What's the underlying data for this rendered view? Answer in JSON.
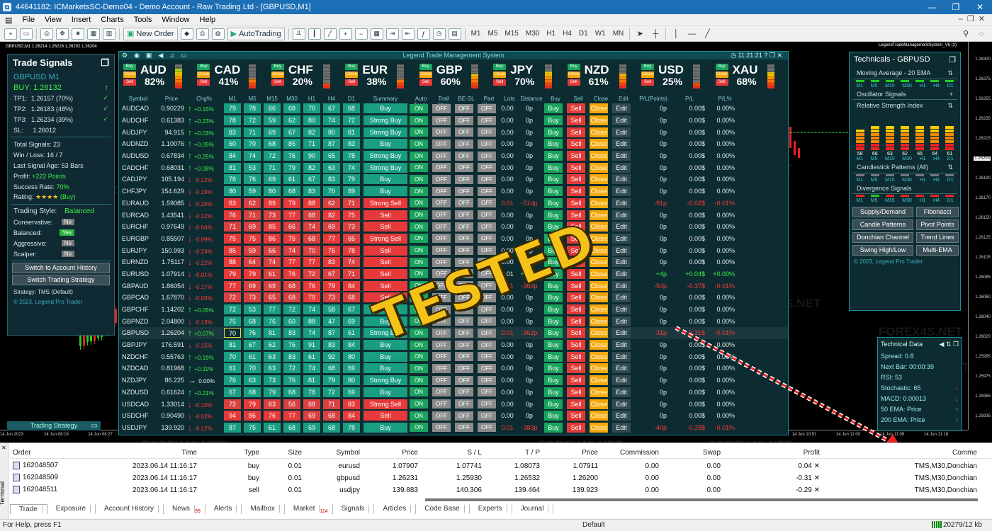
{
  "window": {
    "title": "44641182: ICMarketsSC-Demo04 - Demo Account - Raw Trading Ltd - [GBPUSD,M1]"
  },
  "menu": [
    "File",
    "View",
    "Insert",
    "Charts",
    "Tools",
    "Window",
    "Help"
  ],
  "toolbar": {
    "new_order": "New Order",
    "autotrading": "AutoTrading",
    "timeframes": [
      "M1",
      "M5",
      "M15",
      "M30",
      "H1",
      "H4",
      "D1",
      "W1",
      "MN"
    ]
  },
  "chart": {
    "symbol_label": "GBPUSD,M1  1.26214 1.26216 1.26202 1.26204",
    "indicator_label": "LegendTradeManagementSystem_V6 (2)",
    "prices": [
      "1.26300",
      "1.26275",
      "1.26255",
      "1.26235",
      "1.26215",
      "1.26203",
      "1.26190",
      "1.26170",
      "1.26150",
      "1.26125",
      "1.26105",
      "1.26085",
      "1.26060",
      "1.26040",
      "1.26020",
      "1.25995",
      "1.25975",
      "1.25955",
      "1.25935"
    ],
    "times": [
      "14 Jun 2023",
      "14 Jun 08:18",
      "14 Jun 08:27",
      "14 Jun 08:36",
      "14 Jun 08:45",
      "14 Jun 08:54",
      "14 Jun 09:03",
      "14 Jun 09:12",
      "14 Jun 09:21",
      "14 Jun 09:30",
      "14 Jun 09:39",
      "14 Jun 09:48",
      "14 Jun 09:57",
      "14 Jun 10:06",
      "14 Jun 10:15",
      "14 Jun 10:24",
      "14 Jun 10:33",
      "14 Jun 10:42",
      "14 Jun 10:51",
      "14 Jun 11:00",
      "14 Jun 11:09",
      "14 Jun 11:18"
    ],
    "watermark": "FOREX4S.NET"
  },
  "trade_signals": {
    "title": "Trade Signals",
    "pair": "GBPUSD M1",
    "buy": "BUY: 1.26132",
    "tps": [
      {
        "label": "TP1:",
        "value": "1.26157 (70%)"
      },
      {
        "label": "TP2:",
        "value": "1.26183 (48%)"
      },
      {
        "label": "TP3:",
        "value": "1.26234 (39%)"
      }
    ],
    "sl": {
      "label": "SL:",
      "value": "1.26012"
    },
    "stats": [
      {
        "label": "Total Signals:",
        "value": "23"
      },
      {
        "label": "Win / Loss:",
        "value": "16 / 7"
      },
      {
        "label": "Last Signal Age:",
        "value": "53 Bars"
      }
    ],
    "profit": {
      "label": "Profit:",
      "value": "+222 Points"
    },
    "success": {
      "label": "Success Rate:",
      "value": "70%"
    },
    "rating": {
      "label": "Rating:",
      "stars": "★★★★",
      "value": "(Buy)"
    },
    "style": {
      "label": "Trading Style:",
      "value": "Balanced"
    },
    "styles": [
      {
        "label": "Conservative:",
        "value": "No",
        "on": false
      },
      {
        "label": "Balanced:",
        "value": "Yes",
        "on": true
      },
      {
        "label": "Aggressive:",
        "value": "No",
        "on": false
      },
      {
        "label": "Scalper:",
        "value": "No",
        "on": false
      }
    ],
    "btn_history": "Switch to Account History",
    "btn_strategy": "Switch Trading Strategy",
    "strategy": "Strategy: TMS (Default)",
    "copyright": "© 2023, Legend Pro Trader",
    "collapsed_tab": "Trading Strategy"
  },
  "lts": {
    "title": "Legend Trade Management System",
    "clock": "11:21:21",
    "currencies": [
      {
        "name": "AUD",
        "pct": "82%",
        "level": 82
      },
      {
        "name": "CAD",
        "pct": "41%",
        "level": 41
      },
      {
        "name": "CHF",
        "pct": "20%",
        "level": 20
      },
      {
        "name": "EUR",
        "pct": "38%",
        "level": 38
      },
      {
        "name": "GBP",
        "pct": "60%",
        "level": 60
      },
      {
        "name": "JPY",
        "pct": "70%",
        "level": 70
      },
      {
        "name": "NZD",
        "pct": "61%",
        "level": 61
      },
      {
        "name": "USD",
        "pct": "25%",
        "level": 25
      },
      {
        "name": "XAU",
        "pct": "68%",
        "level": 68
      }
    ],
    "cur_buttons": {
      "buy": "Buy",
      "close": "Close",
      "sell": "Sell"
    },
    "headers": [
      "Symbol",
      "Price",
      "Chg%",
      "M1",
      "M5",
      "M15",
      "M30",
      "H1",
      "H4",
      "D1",
      "Summary",
      "Auto Trade",
      "Trail Stop",
      "BE-SL",
      "Part Close",
      "Lots",
      "Distance",
      "Buy",
      "Sell",
      "Close",
      "Edit",
      "P/L(Points)",
      "P/L",
      "P/L%"
    ],
    "labels": {
      "on": "ON",
      "off": "OFF",
      "buy": "Buy",
      "sell": "Sell",
      "close": "Close",
      "edit": "Edit"
    },
    "rows": [
      {
        "sym": "AUDCAD",
        "price": "0.90229",
        "dir": "up",
        "chg": "+0.15%",
        "tf": [
          79,
          78,
          66,
          68,
          70,
          67,
          68
        ],
        "sum": "Buy",
        "lots": "0.00",
        "dist": "0p",
        "pp": "0p",
        "pl": "0.00$",
        "plp": "0.00%"
      },
      {
        "sym": "AUDCHF",
        "price": "0.61383",
        "dir": "up",
        "chg": "+0.23%",
        "tf": [
          78,
          72,
          59,
          62,
          80,
          74,
          72
        ],
        "sum": "Strong Buy",
        "lots": "0.00",
        "dist": "0p",
        "pp": "0p",
        "pl": "0.00$",
        "plp": "0.00%"
      },
      {
        "sym": "AUDJPY",
        "price": "94.915",
        "dir": "up",
        "chg": "+0.03%",
        "tf": [
          83,
          71,
          69,
          67,
          82,
          80,
          81
        ],
        "sum": "Strong Buy",
        "lots": "0.00",
        "dist": "0p",
        "pp": "0p",
        "pl": "0.00$",
        "plp": "0.00%"
      },
      {
        "sym": "AUDNZD",
        "price": "1.10076",
        "dir": "up",
        "chg": "+0.05%",
        "tf": [
          60,
          70,
          68,
          85,
          71,
          87,
          83
        ],
        "sum": "Buy",
        "lots": "0.00",
        "dist": "0p",
        "pp": "0p",
        "pl": "0.00$",
        "plp": "0.00%"
      },
      {
        "sym": "AUDUSD",
        "price": "0.67834",
        "dir": "up",
        "chg": "+0.25%",
        "tf": [
          84,
          74,
          72,
          76,
          90,
          65,
          78
        ],
        "sum": "Strong Buy",
        "lots": "0.00",
        "dist": "0p",
        "pp": "0p",
        "pl": "0.00$",
        "plp": "0.00%"
      },
      {
        "sym": "CADCHF",
        "price": "0.68031",
        "dir": "up",
        "chg": "+0.08%",
        "tf": [
          81,
          53,
          71,
          79,
          82,
          63,
          74
        ],
        "sum": "Strong Buy",
        "lots": "0.00",
        "dist": "0p",
        "pp": "0p",
        "pl": "0.00$",
        "plp": "0.00%"
      },
      {
        "sym": "CADJPY",
        "price": "105.194",
        "dir": "dn",
        "chg": "-0.12%",
        "tf": [
          76,
          76,
          69,
          61,
          67,
          83,
          79
        ],
        "sum": "Buy",
        "lots": "0.00",
        "dist": "0p",
        "pp": "0p",
        "pl": "0.00$",
        "plp": "0.00%"
      },
      {
        "sym": "CHFJPY",
        "price": "154.629",
        "dir": "dn",
        "chg": "-0.19%",
        "tf": [
          80,
          59,
          80,
          68,
          83,
          70,
          89
        ],
        "sum": "Buy",
        "lots": "0.00",
        "dist": "0p",
        "pp": "0p",
        "pl": "0.00$",
        "plp": "0.00%"
      },
      {
        "sym": "EURAUD",
        "price": "1.59085",
        "dir": "dn",
        "chg": "-0.26%",
        "tf": [
          83,
          62,
          89,
          79,
          88,
          62,
          71
        ],
        "sum": "Strong Sell",
        "lots": "0.01",
        "dist": "-51dp",
        "pp": "-91p",
        "pl": "-0.62$",
        "plp": "-0.01%",
        "neg": true
      },
      {
        "sym": "EURCAD",
        "price": "1.43541",
        "dir": "dn",
        "chg": "-0.12%",
        "tf": [
          76,
          71,
          73,
          77,
          68,
          82,
          75
        ],
        "sum": "Sell",
        "lots": "0.00",
        "dist": "0p",
        "pp": "0p",
        "pl": "0.00$",
        "plp": "0.00%"
      },
      {
        "sym": "EURCHF",
        "price": "0.97649",
        "dir": "dn",
        "chg": "-0.04%",
        "tf": [
          71,
          69,
          85,
          66,
          74,
          69,
          73
        ],
        "sum": "Sell",
        "lots": "0.00",
        "dist": "0p",
        "pp": "0p",
        "pl": "0.00$",
        "plp": "0.00%"
      },
      {
        "sym": "EURGBP",
        "price": "0.85507",
        "dir": "dn",
        "chg": "-0.09%",
        "tf": [
          75,
          75,
          86,
          75,
          68,
          77,
          65
        ],
        "sum": "Strong Sell",
        "lots": "0.00",
        "dist": "0p",
        "pp": "0p",
        "pl": "0.00$",
        "plp": "0.00%"
      },
      {
        "sym": "EURJPY",
        "price": "150.993",
        "dir": "dn",
        "chg": "-0.24%",
        "tf": [
          85,
          59,
          66,
          74,
          70,
          76,
          78
        ],
        "sum": "Sell",
        "lots": "0.00",
        "dist": "0p",
        "pp": "0p",
        "pl": "0.00$",
        "plp": "0.00%"
      },
      {
        "sym": "EURNZD",
        "price": "1.75117",
        "dir": "dn",
        "chg": "-0.22%",
        "tf": [
          88,
          64,
          74,
          77,
          77,
          83,
          74
        ],
        "sum": "Sell",
        "lots": "0.00",
        "dist": "0p",
        "pp": "0p",
        "pl": "0.00$",
        "plp": "0.00%"
      },
      {
        "sym": "EURUSD",
        "price": "1.07914",
        "dir": "dn",
        "chg": "-0.01%",
        "tf": [
          79,
          79,
          61,
          76,
          72,
          67,
          71
        ],
        "sum": "Sell",
        "lots": "0.01",
        "dist": "+162p",
        "pp": "+4p",
        "pl": "+0.04$",
        "plp": "+0.00%",
        "pos": true
      },
      {
        "sym": "GBPAUD",
        "price": "1.86054",
        "dir": "dn",
        "chg": "-0.17%",
        "tf": [
          77,
          69,
          69,
          68,
          76,
          79,
          84
        ],
        "sum": "Sell",
        "lots": "0.01",
        "dist": "-368p",
        "pp": "-54p",
        "pl": "-0.37$",
        "plp": "-0.01%",
        "neg": true
      },
      {
        "sym": "GBPCAD",
        "price": "1.67870",
        "dir": "dn",
        "chg": "-0.03%",
        "tf": [
          72,
          73,
          65,
          68,
          79,
          73,
          68
        ],
        "sum": "Sell",
        "lots": "0.00",
        "dist": "0p",
        "pp": "0p",
        "pl": "0.00$",
        "plp": "0.00%"
      },
      {
        "sym": "GBPCHF",
        "price": "1.14202",
        "dir": "up",
        "chg": "+0.05%",
        "tf": [
          72,
          53,
          77,
          72,
          74,
          58,
          67
        ],
        "sum": "Buy",
        "lots": "0.00",
        "dist": "0p",
        "pp": "0p",
        "pl": "0.00$",
        "plp": "0.00%"
      },
      {
        "sym": "GBPNZD",
        "price": "2.04800",
        "dir": "dn",
        "chg": "-0.13%",
        "tf": [
          75,
          68,
          76,
          60,
          88,
          47,
          69
        ],
        "sum": "Buy",
        "lots": "0.00",
        "dist": "0p",
        "pp": "0p",
        "pl": "0.00$",
        "plp": "0.00%"
      },
      {
        "sym": "GBPUSD",
        "price": "1.26204",
        "dir": "up",
        "chg": "+0.07%",
        "tf": [
          70,
          76,
          81,
          83,
          74,
          87,
          61
        ],
        "sum": "Strong Buy",
        "lots": "0.01",
        "dist": "-362p",
        "pp": "-31p",
        "pl": "-0.31$",
        "plp": "-0.01%",
        "neg": true,
        "hl": true
      },
      {
        "sym": "GBPJPY",
        "price": "176.591",
        "dir": "dn",
        "chg": "-0.15%",
        "tf": [
          81,
          67,
          62,
          76,
          91,
          83,
          84
        ],
        "sum": "Buy",
        "lots": "0.00",
        "dist": "0p",
        "pp": "0p",
        "pl": "0.00$",
        "plp": "0.00%"
      },
      {
        "sym": "NZDCHF",
        "price": "0.55763",
        "dir": "up",
        "chg": "+0.19%",
        "tf": [
          70,
          61,
          63,
          83,
          61,
          92,
          80
        ],
        "sum": "Buy",
        "lots": "0.00",
        "dist": "0p",
        "pp": "0p",
        "pl": "0.00$",
        "plp": "0.00%"
      },
      {
        "sym": "NZDCAD",
        "price": "0.81968",
        "dir": "up",
        "chg": "+0.11%",
        "tf": [
          61,
          70,
          63,
          72,
          74,
          68,
          69
        ],
        "sum": "Buy",
        "lots": "0.00",
        "dist": "0p",
        "pp": "0p",
        "pl": "0.00$",
        "plp": "0.00%"
      },
      {
        "sym": "NZDJPY",
        "price": "86.225",
        "dir": "fl",
        "chg": "0.00%",
        "tf": [
          76,
          63,
          73,
          76,
          81,
          79,
          80
        ],
        "sum": "Strong Buy",
        "lots": "0.00",
        "dist": "0p",
        "pp": "0p",
        "pl": "0.00$",
        "plp": "0.00%"
      },
      {
        "sym": "NZDUSD",
        "price": "0.61624",
        "dir": "up",
        "chg": "+0.21%",
        "tf": [
          67,
          68,
          79,
          68,
          78,
          72,
          69
        ],
        "sum": "Buy",
        "lots": "0.00",
        "dist": "0p",
        "pp": "0p",
        "pl": "0.00$",
        "plp": "0.00%"
      },
      {
        "sym": "USDCAD",
        "price": "1.33014",
        "dir": "dn",
        "chg": "-0.10%",
        "tf": [
          72,
          79,
          63,
          56,
          68,
          71,
          83
        ],
        "sum": "Strong Sell",
        "lots": "0.00",
        "dist": "0p",
        "pp": "0p",
        "pl": "0.00$",
        "plp": "0.00%"
      },
      {
        "sym": "USDCHF",
        "price": "0.90490",
        "dir": "dn",
        "chg": "-0.02%",
        "tf": [
          94,
          86,
          76,
          77,
          69,
          68,
          84
        ],
        "sum": "Sell",
        "lots": "0.00",
        "dist": "0p",
        "pp": "0p",
        "pl": "0.00$",
        "plp": "0.00%"
      },
      {
        "sym": "USDJPY",
        "price": "139.920",
        "dir": "dn",
        "chg": "-0.12%",
        "tf": [
          87,
          75,
          61,
          68,
          69,
          68,
          78
        ],
        "sum": "Buy",
        "lots": "0.01",
        "dist": "-383p",
        "pp": "-40p",
        "pl": "-0.29$",
        "plp": "-0.01%",
        "neg": true
      }
    ]
  },
  "technicals": {
    "title": "Technicals - GBPUSD",
    "ma": "Moving Average - 20 EMA",
    "tfs": [
      "M1",
      "M5",
      "M15",
      "M30",
      "H1",
      "H4",
      "D1"
    ],
    "osc": "Oscillator Signals",
    "rsi": "Relative Strength Index",
    "rsi_values": [
      "58",
      "66",
      "63",
      "62",
      "65",
      "64",
      "61"
    ],
    "candle": "Candlestick Patterns (All)",
    "div": "Divergence Signals",
    "buttons": [
      "Supply/Demand",
      "Fibonacci",
      "Candle Patterns",
      "Pivot Points",
      "Donchian Channel",
      "Trend Lines",
      "Swing High/Low",
      "Multi-EMA"
    ],
    "copyright": "© 2023, Legend Pro Trader"
  },
  "tech_data": {
    "title": "Technical Data",
    "rows": [
      {
        "label": "Spread: 0.8",
        "sig": ""
      },
      {
        "label": "Next Bar: 00:00:39",
        "sig": ""
      },
      {
        "label": "RSI: 53",
        "sig": ""
      },
      {
        "label": "Stochastic: 65",
        "sig": "down"
      },
      {
        "label": "MACD: 0.00013",
        "sig": "down"
      },
      {
        "label": "50 EMA:  Price",
        "sig": "up"
      },
      {
        "label": "200 EMA:  Price",
        "sig": "up"
      }
    ]
  },
  "stamp": "TESTED",
  "terminal": {
    "side_label": "Terminal",
    "headers": [
      "Order",
      "Time",
      "Type",
      "Size",
      "Symbol",
      "Price",
      "S / L",
      "T / P",
      "Price",
      "Commission",
      "Swap",
      "Profit",
      "Comme"
    ],
    "orders": [
      {
        "order": "162048507",
        "time": "2023.06.14 11:16:17",
        "type": "buy",
        "size": "0.01",
        "symbol": "eurusd",
        "price": "1.07907",
        "sl": "1.07741",
        "tp": "1.08073",
        "cur": "1.07911",
        "comm": "0.00",
        "swap": "0.00",
        "profit": "0.04",
        "comment": "TMS,M30,Donchian"
      },
      {
        "order": "162048509",
        "time": "2023.06.14 11:16:17",
        "type": "buy",
        "size": "0.01",
        "symbol": "gbpusd",
        "price": "1.26231",
        "sl": "1.25930",
        "tp": "1.26532",
        "cur": "1.26200",
        "comm": "0.00",
        "swap": "0.00",
        "profit": "-0.31",
        "comment": "TMS,M30,Donchian"
      },
      {
        "order": "162048511",
        "time": "2023.06.14 11:16:17",
        "type": "sell",
        "size": "0.01",
        "symbol": "usdjpy",
        "price": "139.883",
        "sl": "140.306",
        "tp": "139.464",
        "cur": "139.923",
        "comm": "0.00",
        "swap": "0.00",
        "profit": "-0.29",
        "comment": "TMS,M30,Donchian"
      }
    ],
    "tabs": [
      {
        "label": "Trade",
        "badge": ""
      },
      {
        "label": "Exposure",
        "badge": ""
      },
      {
        "label": "Account History",
        "badge": ""
      },
      {
        "label": "News",
        "badge": "99"
      },
      {
        "label": "Alerts",
        "badge": ""
      },
      {
        "label": "Mailbox",
        "badge": ""
      },
      {
        "label": "Market",
        "badge": "114"
      },
      {
        "label": "Signals",
        "badge": ""
      },
      {
        "label": "Articles",
        "badge": ""
      },
      {
        "label": "Code Base",
        "badge": ""
      },
      {
        "label": "Experts",
        "badge": ""
      },
      {
        "label": "Journal",
        "badge": ""
      }
    ]
  },
  "status": {
    "help": "For Help, press F1",
    "profile": "Default",
    "traffic": "20279/12 kb"
  },
  "colors": {
    "buy": "#1aa35e",
    "sell": "#e63a3a",
    "close": "#f5a80a",
    "edit": "#6d7a7f",
    "on": "#1aa35e",
    "off": "#8b8b8b",
    "teal": "#1e8c96"
  }
}
